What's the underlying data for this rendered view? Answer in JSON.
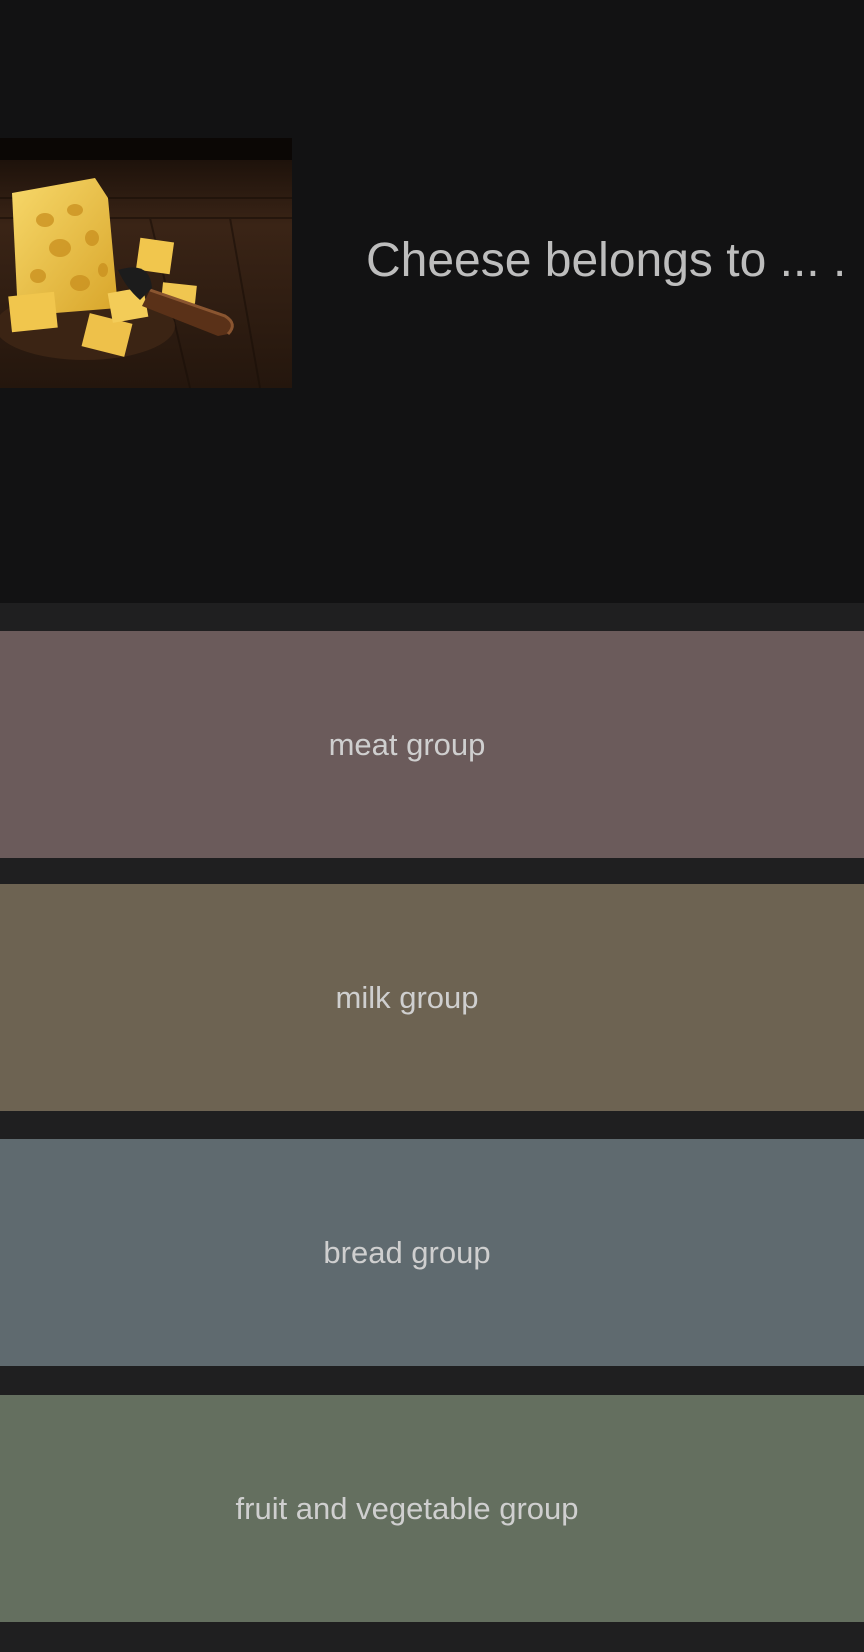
{
  "question": {
    "text": "Cheese belongs to ... .",
    "image_icon": "cheese-photo"
  },
  "answers": [
    {
      "label": "meat group",
      "color": "#6b5b5b"
    },
    {
      "label": "milk group",
      "color": "#6d6352"
    },
    {
      "label": "bread group",
      "color": "#5f6a6f"
    },
    {
      "label": "fruit and vegetable group",
      "color": "#646f5f"
    }
  ],
  "colors": {
    "background": "#1f1f20",
    "question_panel": "#121213",
    "text": "#cfcfcf"
  }
}
